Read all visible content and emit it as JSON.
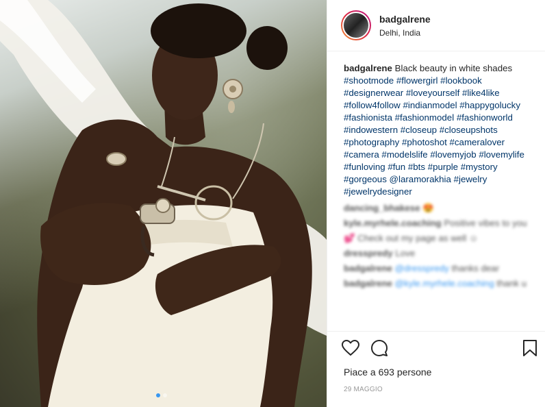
{
  "post": {
    "username": "badgalrene",
    "location": "Delhi, India",
    "caption_text": "Black beauty in white shades",
    "hashtags": "#shootmode #flowergirl #lookbook #designerwear #loveyourself #like4like #follow4follow #indianmodel #happygolucky #fashionista #fashionmodel #fashionworld #indowestern #closeup #closeupshots #photography #photoshot #cameralover #camera #modelslife #lovemyjob #lovemylife #funloving #fun #bts #purple #mystory #gorgeous @laramorakhia #jewelry #jewelrydesigner",
    "likes_text": "Piace a 693 persone",
    "date": "29 MAGGIO"
  },
  "blurred_comments": [
    {
      "user": "dancing_bhakese",
      "text": "😍"
    },
    {
      "user": "kyle.myrhele.coaching",
      "text": "Positive vibes to you 💕 Check out my page as well ☺"
    },
    {
      "user": "dresspredy",
      "text": "Love"
    },
    {
      "user": "badgalrene",
      "mention": "@dresspredy",
      "text": "thanks dear"
    },
    {
      "user": "badgalrene",
      "mention": "@kyle.myrhele.coaching",
      "text": "thank u"
    }
  ],
  "icons": {
    "like": "heart-icon",
    "comment": "comment-bubble-icon",
    "save": "bookmark-icon"
  },
  "carousel": {
    "count": 2,
    "active": 0
  },
  "colors": {
    "link": "#003569",
    "accent": "#3897f0",
    "muted": "#999999"
  }
}
